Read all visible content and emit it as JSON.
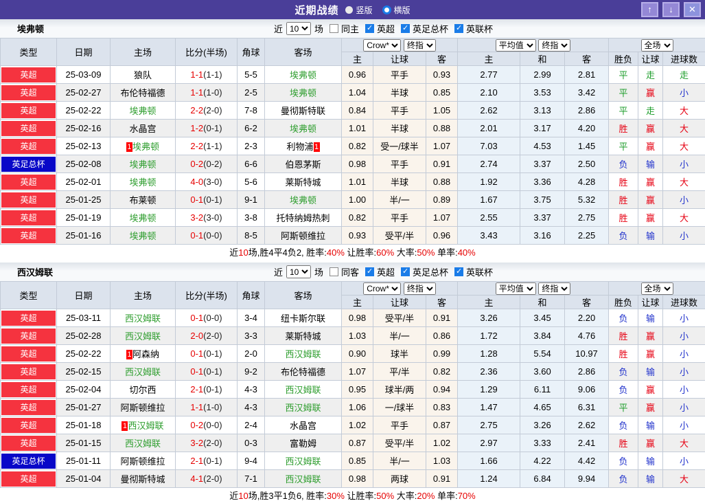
{
  "titlebar": {
    "title": "近期战绩",
    "radio_vertical": "竖版",
    "radio_horizontal": "横版",
    "up_glyph": "↑",
    "down_glyph": "↓",
    "close_glyph": "✕",
    "bar_color": "#4a3e99"
  },
  "selects": {
    "odds_company": "Crow*",
    "odds_time": "终指",
    "avg": "平均值",
    "avg_time": "终指",
    "scope": "全场"
  },
  "table_header": {
    "type": "类型",
    "date": "日期",
    "home": "主场",
    "score": "比分(半场)",
    "corner": "角球",
    "away": "客场",
    "sub": [
      "主",
      "让球",
      "客",
      "主",
      "和",
      "客",
      "胜负",
      "让球",
      "进球数"
    ]
  },
  "colors": {
    "league_red": "#f5333f",
    "league_blue": "#0808c8",
    "win": "#e60012",
    "draw": "#1f9e2c",
    "lose": "#2233cc"
  },
  "sections": [
    {
      "team": "埃弗顿",
      "filter": {
        "near": "近",
        "count": "10",
        "games": "场",
        "same": "同主",
        "leagues": [
          "英超",
          "英足总杯",
          "英联杯"
        ]
      },
      "rows": [
        {
          "league": "英超",
          "lt": "red",
          "date": "25-03-09",
          "home": "狼队",
          "hs": false,
          "hc": false,
          "score": "1-1",
          "half": "(1-1)",
          "corner": "5-5",
          "away": "埃弗顿",
          "as": true,
          "ac": false,
          "w1": "0.96",
          "hcap": "平手",
          "w2": "0.93",
          "m1": "2.77",
          "m2": "2.99",
          "m3": "2.81",
          "r1": "平",
          "c1": "g",
          "r2": "走",
          "c2": "g",
          "r3": "走",
          "c3": "g"
        },
        {
          "league": "英超",
          "lt": "red",
          "date": "25-02-27",
          "home": "布伦特福德",
          "hs": false,
          "hc": false,
          "score": "1-1",
          "half": "(1-0)",
          "corner": "2-5",
          "away": "埃弗顿",
          "as": true,
          "ac": false,
          "w1": "1.04",
          "hcap": "半球",
          "w2": "0.85",
          "m1": "2.10",
          "m2": "3.53",
          "m3": "3.42",
          "r1": "平",
          "c1": "g",
          "r2": "赢",
          "c2": "r",
          "r3": "小",
          "c3": "b"
        },
        {
          "league": "英超",
          "lt": "red",
          "date": "25-02-22",
          "home": "埃弗顿",
          "hs": true,
          "hc": false,
          "score": "2-2",
          "half": "(2-0)",
          "corner": "7-8",
          "away": "曼彻斯特联",
          "as": false,
          "ac": false,
          "w1": "0.84",
          "hcap": "平手",
          "w2": "1.05",
          "m1": "2.62",
          "m2": "3.13",
          "m3": "2.86",
          "r1": "平",
          "c1": "g",
          "r2": "走",
          "c2": "g",
          "r3": "大",
          "c3": "r"
        },
        {
          "league": "英超",
          "lt": "red",
          "date": "25-02-16",
          "home": "水晶宫",
          "hs": false,
          "hc": false,
          "score": "1-2",
          "half": "(0-1)",
          "corner": "6-2",
          "away": "埃弗顿",
          "as": true,
          "ac": false,
          "w1": "1.01",
          "hcap": "半球",
          "w2": "0.88",
          "m1": "2.01",
          "m2": "3.17",
          "m3": "4.20",
          "r1": "胜",
          "c1": "r",
          "r2": "赢",
          "c2": "r",
          "r3": "大",
          "c3": "r"
        },
        {
          "league": "英超",
          "lt": "red",
          "date": "25-02-13",
          "home": "埃弗顿",
          "hs": true,
          "hc": true,
          "score": "2-2",
          "half": "(1-1)",
          "corner": "2-3",
          "away": "利物浦",
          "as": false,
          "ac": true,
          "w1": "0.82",
          "hcap": "受一/球半",
          "w2": "1.07",
          "m1": "7.03",
          "m2": "4.53",
          "m3": "1.45",
          "r1": "平",
          "c1": "g",
          "r2": "赢",
          "c2": "r",
          "r3": "大",
          "c3": "r"
        },
        {
          "league": "英足总杯",
          "lt": "blue",
          "date": "25-02-08",
          "home": "埃弗顿",
          "hs": true,
          "hc": false,
          "score": "0-2",
          "half": "(0-2)",
          "corner": "6-6",
          "away": "伯恩茅斯",
          "as": false,
          "ac": false,
          "w1": "0.98",
          "hcap": "平手",
          "w2": "0.91",
          "m1": "2.74",
          "m2": "3.37",
          "m3": "2.50",
          "r1": "负",
          "c1": "b",
          "r2": "输",
          "c2": "b",
          "r3": "小",
          "c3": "b"
        },
        {
          "league": "英超",
          "lt": "red",
          "date": "25-02-01",
          "home": "埃弗顿",
          "hs": true,
          "hc": false,
          "score": "4-0",
          "half": "(3-0)",
          "corner": "5-6",
          "away": "莱斯特城",
          "as": false,
          "ac": false,
          "w1": "1.01",
          "hcap": "半球",
          "w2": "0.88",
          "m1": "1.92",
          "m2": "3.36",
          "m3": "4.28",
          "r1": "胜",
          "c1": "r",
          "r2": "赢",
          "c2": "r",
          "r3": "大",
          "c3": "r"
        },
        {
          "league": "英超",
          "lt": "red",
          "date": "25-01-25",
          "home": "布莱顿",
          "hs": false,
          "hc": false,
          "score": "0-1",
          "half": "(0-1)",
          "corner": "9-1",
          "away": "埃弗顿",
          "as": true,
          "ac": false,
          "w1": "1.00",
          "hcap": "半/一",
          "w2": "0.89",
          "m1": "1.67",
          "m2": "3.75",
          "m3": "5.32",
          "r1": "胜",
          "c1": "r",
          "r2": "赢",
          "c2": "r",
          "r3": "小",
          "c3": "b"
        },
        {
          "league": "英超",
          "lt": "red",
          "date": "25-01-19",
          "home": "埃弗顿",
          "hs": true,
          "hc": false,
          "score": "3-2",
          "half": "(3-0)",
          "corner": "3-8",
          "away": "托特纳姆热刺",
          "as": false,
          "ac": false,
          "w1": "0.82",
          "hcap": "平手",
          "w2": "1.07",
          "m1": "2.55",
          "m2": "3.37",
          "m3": "2.75",
          "r1": "胜",
          "c1": "r",
          "r2": "赢",
          "c2": "r",
          "r3": "大",
          "c3": "r"
        },
        {
          "league": "英超",
          "lt": "red",
          "date": "25-01-16",
          "home": "埃弗顿",
          "hs": true,
          "hc": false,
          "score": "0-1",
          "half": "(0-0)",
          "corner": "8-5",
          "away": "阿斯顿维拉",
          "as": false,
          "ac": false,
          "w1": "0.93",
          "hcap": "受平/半",
          "w2": "0.96",
          "m1": "3.43",
          "m2": "3.16",
          "m3": "2.25",
          "r1": "负",
          "c1": "b",
          "r2": "输",
          "c2": "b",
          "r3": "小",
          "c3": "b"
        }
      ],
      "summary": [
        {
          "t": "近"
        },
        {
          "t": "10",
          "red": true
        },
        {
          "t": "场,胜4平4负2, 胜率:"
        },
        {
          "t": "40%",
          "red": true
        },
        {
          "t": " 让胜率:"
        },
        {
          "t": "60%",
          "red": true
        },
        {
          "t": " 大率:"
        },
        {
          "t": "50%",
          "red": true
        },
        {
          "t": " 单率:"
        },
        {
          "t": "40%",
          "red": true
        }
      ]
    },
    {
      "team": "西汉姆联",
      "filter": {
        "near": "近",
        "count": "10",
        "games": "场",
        "same": "同客",
        "leagues": [
          "英超",
          "英足总杯",
          "英联杯"
        ]
      },
      "rows": [
        {
          "league": "英超",
          "lt": "red",
          "date": "25-03-11",
          "home": "西汉姆联",
          "hs": true,
          "hc": false,
          "score": "0-1",
          "half": "(0-0)",
          "corner": "3-4",
          "away": "纽卡斯尔联",
          "as": false,
          "ac": false,
          "w1": "0.98",
          "hcap": "受平/半",
          "w2": "0.91",
          "m1": "3.26",
          "m2": "3.45",
          "m3": "2.20",
          "r1": "负",
          "c1": "b",
          "r2": "输",
          "c2": "b",
          "r3": "小",
          "c3": "b"
        },
        {
          "league": "英超",
          "lt": "red",
          "date": "25-02-28",
          "home": "西汉姆联",
          "hs": true,
          "hc": false,
          "score": "2-0",
          "half": "(2-0)",
          "corner": "3-3",
          "away": "莱斯特城",
          "as": false,
          "ac": false,
          "w1": "1.03",
          "hcap": "半/一",
          "w2": "0.86",
          "m1": "1.72",
          "m2": "3.84",
          "m3": "4.76",
          "r1": "胜",
          "c1": "r",
          "r2": "赢",
          "c2": "r",
          "r3": "小",
          "c3": "b"
        },
        {
          "league": "英超",
          "lt": "red",
          "date": "25-02-22",
          "home": "阿森纳",
          "hs": false,
          "hc": true,
          "score": "0-1",
          "half": "(0-1)",
          "corner": "2-0",
          "away": "西汉姆联",
          "as": true,
          "ac": false,
          "w1": "0.90",
          "hcap": "球半",
          "w2": "0.99",
          "m1": "1.28",
          "m2": "5.54",
          "m3": "10.97",
          "r1": "胜",
          "c1": "r",
          "r2": "赢",
          "c2": "r",
          "r3": "小",
          "c3": "b"
        },
        {
          "league": "英超",
          "lt": "red",
          "date": "25-02-15",
          "home": "西汉姆联",
          "hs": true,
          "hc": false,
          "score": "0-1",
          "half": "(0-1)",
          "corner": "9-2",
          "away": "布伦特福德",
          "as": false,
          "ac": false,
          "w1": "1.07",
          "hcap": "平/半",
          "w2": "0.82",
          "m1": "2.36",
          "m2": "3.60",
          "m3": "2.86",
          "r1": "负",
          "c1": "b",
          "r2": "输",
          "c2": "b",
          "r3": "小",
          "c3": "b"
        },
        {
          "league": "英超",
          "lt": "red",
          "date": "25-02-04",
          "home": "切尔西",
          "hs": false,
          "hc": false,
          "score": "2-1",
          "half": "(0-1)",
          "corner": "4-3",
          "away": "西汉姆联",
          "as": true,
          "ac": false,
          "w1": "0.95",
          "hcap": "球半/两",
          "w2": "0.94",
          "m1": "1.29",
          "m2": "6.11",
          "m3": "9.06",
          "r1": "负",
          "c1": "b",
          "r2": "赢",
          "c2": "r",
          "r3": "小",
          "c3": "b"
        },
        {
          "league": "英超",
          "lt": "red",
          "date": "25-01-27",
          "home": "阿斯顿维拉",
          "hs": false,
          "hc": false,
          "score": "1-1",
          "half": "(1-0)",
          "corner": "4-3",
          "away": "西汉姆联",
          "as": true,
          "ac": false,
          "w1": "1.06",
          "hcap": "一/球半",
          "w2": "0.83",
          "m1": "1.47",
          "m2": "4.65",
          "m3": "6.31",
          "r1": "平",
          "c1": "g",
          "r2": "赢",
          "c2": "r",
          "r3": "小",
          "c3": "b"
        },
        {
          "league": "英超",
          "lt": "red",
          "date": "25-01-18",
          "home": "西汉姆联",
          "hs": true,
          "hc": true,
          "score": "0-2",
          "half": "(0-0)",
          "corner": "2-4",
          "away": "水晶宫",
          "as": false,
          "ac": false,
          "w1": "1.02",
          "hcap": "平手",
          "w2": "0.87",
          "m1": "2.75",
          "m2": "3.26",
          "m3": "2.62",
          "r1": "负",
          "c1": "b",
          "r2": "输",
          "c2": "b",
          "r3": "小",
          "c3": "b"
        },
        {
          "league": "英超",
          "lt": "red",
          "date": "25-01-15",
          "home": "西汉姆联",
          "hs": true,
          "hc": false,
          "score": "3-2",
          "half": "(2-0)",
          "corner": "0-3",
          "away": "富勒姆",
          "as": false,
          "ac": false,
          "w1": "0.87",
          "hcap": "受平/半",
          "w2": "1.02",
          "m1": "2.97",
          "m2": "3.33",
          "m3": "2.41",
          "r1": "胜",
          "c1": "r",
          "r2": "赢",
          "c2": "r",
          "r3": "大",
          "c3": "r"
        },
        {
          "league": "英足总杯",
          "lt": "blue",
          "date": "25-01-11",
          "home": "阿斯顿维拉",
          "hs": false,
          "hc": false,
          "score": "2-1",
          "half": "(0-1)",
          "corner": "9-4",
          "away": "西汉姆联",
          "as": true,
          "ac": false,
          "w1": "0.85",
          "hcap": "半/一",
          "w2": "1.03",
          "m1": "1.66",
          "m2": "4.22",
          "m3": "4.42",
          "r1": "负",
          "c1": "b",
          "r2": "输",
          "c2": "b",
          "r3": "小",
          "c3": "b"
        },
        {
          "league": "英超",
          "lt": "red",
          "date": "25-01-04",
          "home": "曼彻斯特城",
          "hs": false,
          "hc": false,
          "score": "4-1",
          "half": "(2-0)",
          "corner": "7-1",
          "away": "西汉姆联",
          "as": true,
          "ac": false,
          "w1": "0.98",
          "hcap": "两球",
          "w2": "0.91",
          "m1": "1.24",
          "m2": "6.84",
          "m3": "9.94",
          "r1": "负",
          "c1": "b",
          "r2": "输",
          "c2": "b",
          "r3": "大",
          "c3": "r"
        }
      ],
      "summary": [
        {
          "t": "近"
        },
        {
          "t": "10",
          "red": true
        },
        {
          "t": "场,胜3平1负6, 胜率:"
        },
        {
          "t": "30%",
          "red": true
        },
        {
          "t": " 让胜率:"
        },
        {
          "t": "50%",
          "red": true
        },
        {
          "t": " 大率:"
        },
        {
          "t": "20%",
          "red": true
        },
        {
          "t": " 单率:"
        },
        {
          "t": "70%",
          "red": true
        }
      ]
    }
  ]
}
